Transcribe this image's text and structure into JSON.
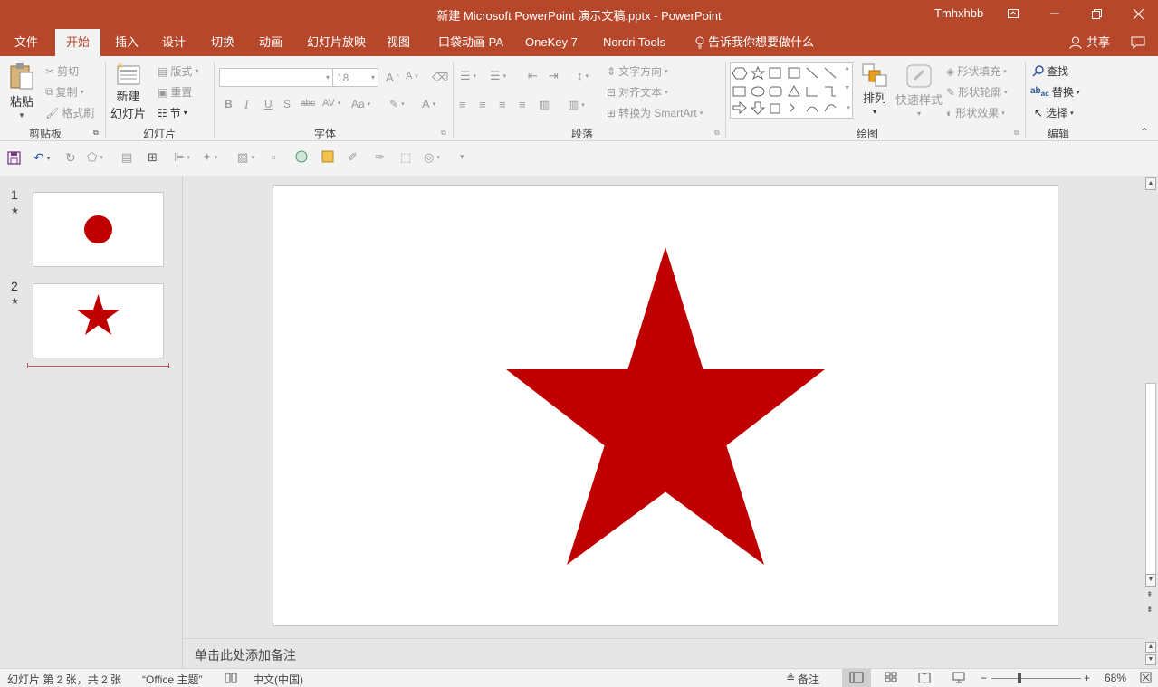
{
  "window": {
    "title": "新建 Microsoft PowerPoint 演示文稿.pptx  -  PowerPoint",
    "user": "Tmhxhbb"
  },
  "tabs": [
    {
      "label": "文件"
    },
    {
      "label": "开始"
    },
    {
      "label": "插入"
    },
    {
      "label": "设计"
    },
    {
      "label": "切换"
    },
    {
      "label": "动画"
    },
    {
      "label": "幻灯片放映"
    },
    {
      "label": "视图"
    },
    {
      "label": "口袋动画 PA"
    },
    {
      "label": "OneKey 7"
    },
    {
      "label": "Nordri Tools"
    },
    {
      "label": "告诉我你想要做什么"
    }
  ],
  "share_label": "共享",
  "ribbon": {
    "clipboard": {
      "paste": "粘贴",
      "cut": "剪切",
      "copy": "复制",
      "format_painter": "格式刷",
      "group": "剪贴板"
    },
    "slides": {
      "new_slide_1": "新建",
      "new_slide_2": "幻灯片",
      "layout": "版式",
      "reset": "重置",
      "section": "节",
      "group": "幻灯片"
    },
    "font": {
      "font_name": "",
      "font_size": "18",
      "group": "字体"
    },
    "paragraph": {
      "text_direction": "文字方向",
      "align_text": "对齐文本",
      "smartart": "转换为 SmartArt",
      "group": "段落"
    },
    "drawing": {
      "arrange": "排列",
      "quick_styles": "快速样式",
      "shape_fill": "形状填充",
      "shape_outline": "形状轮廓",
      "shape_effects": "形状效果",
      "group": "绘图"
    },
    "editing": {
      "find": "查找",
      "replace": "替换",
      "select": "选择",
      "group": "编辑"
    }
  },
  "slides": [
    {
      "number": "1",
      "star": "★",
      "shape": "circle"
    },
    {
      "number": "2",
      "star": "★",
      "shape": "star"
    }
  ],
  "notes_placeholder": "单击此处添加备注",
  "status": {
    "slide_info": "幻灯片 第 2 张，共 2 张",
    "theme": "“Office 主题”",
    "language": "中文(中国)",
    "notes": "备注",
    "zoom": "68%"
  },
  "colors": {
    "accent": "#b7472a",
    "shape_fill": "#c00000"
  }
}
